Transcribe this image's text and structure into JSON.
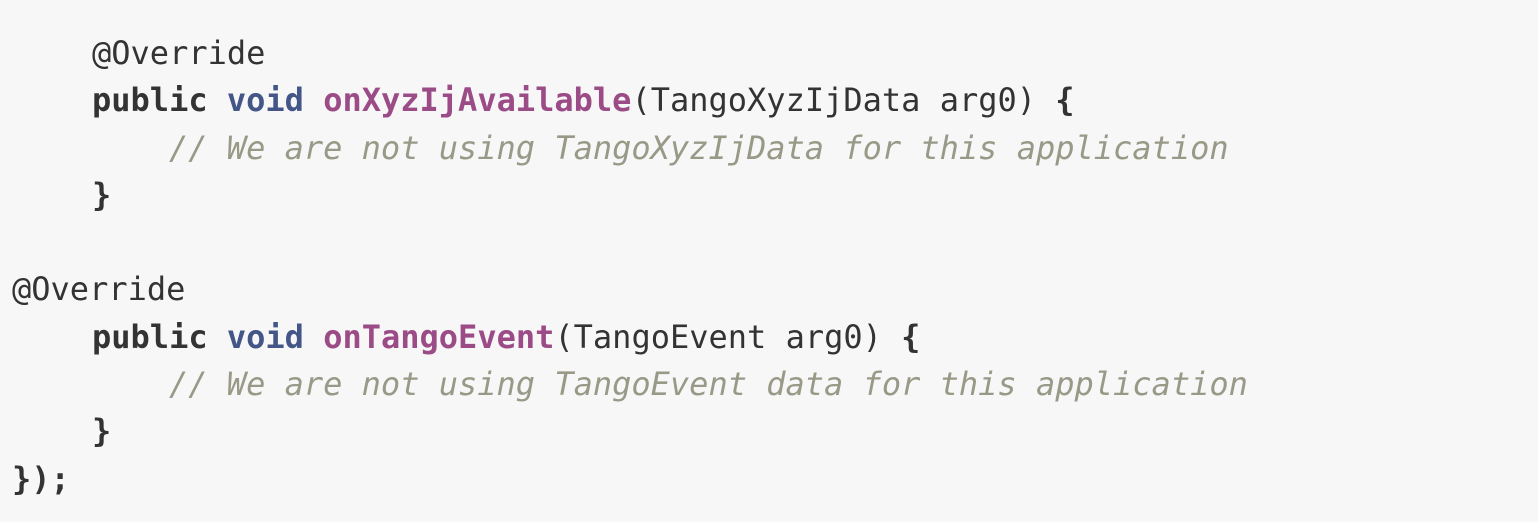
{
  "code": {
    "line1": {
      "annotation": "@Override"
    },
    "line2": {
      "modifier": "public",
      "return_type": "void",
      "method": "onXyzIjAvailable",
      "params": "(TangoXyzIjData arg0) ",
      "brace": "{"
    },
    "line3": {
      "comment": "// We are not using TangoXyzIjData for this application"
    },
    "line4": {
      "brace": "}"
    },
    "line5": {
      "blank": ""
    },
    "line6": {
      "annotation": "@Override"
    },
    "line7": {
      "modifier": "public",
      "return_type": "void",
      "method": "onTangoEvent",
      "params": "(TangoEvent arg0) ",
      "brace": "{"
    },
    "line8": {
      "comment": "// We are not using TangoEvent data for this application"
    },
    "line9": {
      "brace": "}"
    },
    "line10": {
      "closing": "});"
    }
  },
  "colors": {
    "background": "#f7f7f7",
    "keyword": "#333333",
    "type": "#445588",
    "method": "#9b4b86",
    "comment": "#999988"
  }
}
